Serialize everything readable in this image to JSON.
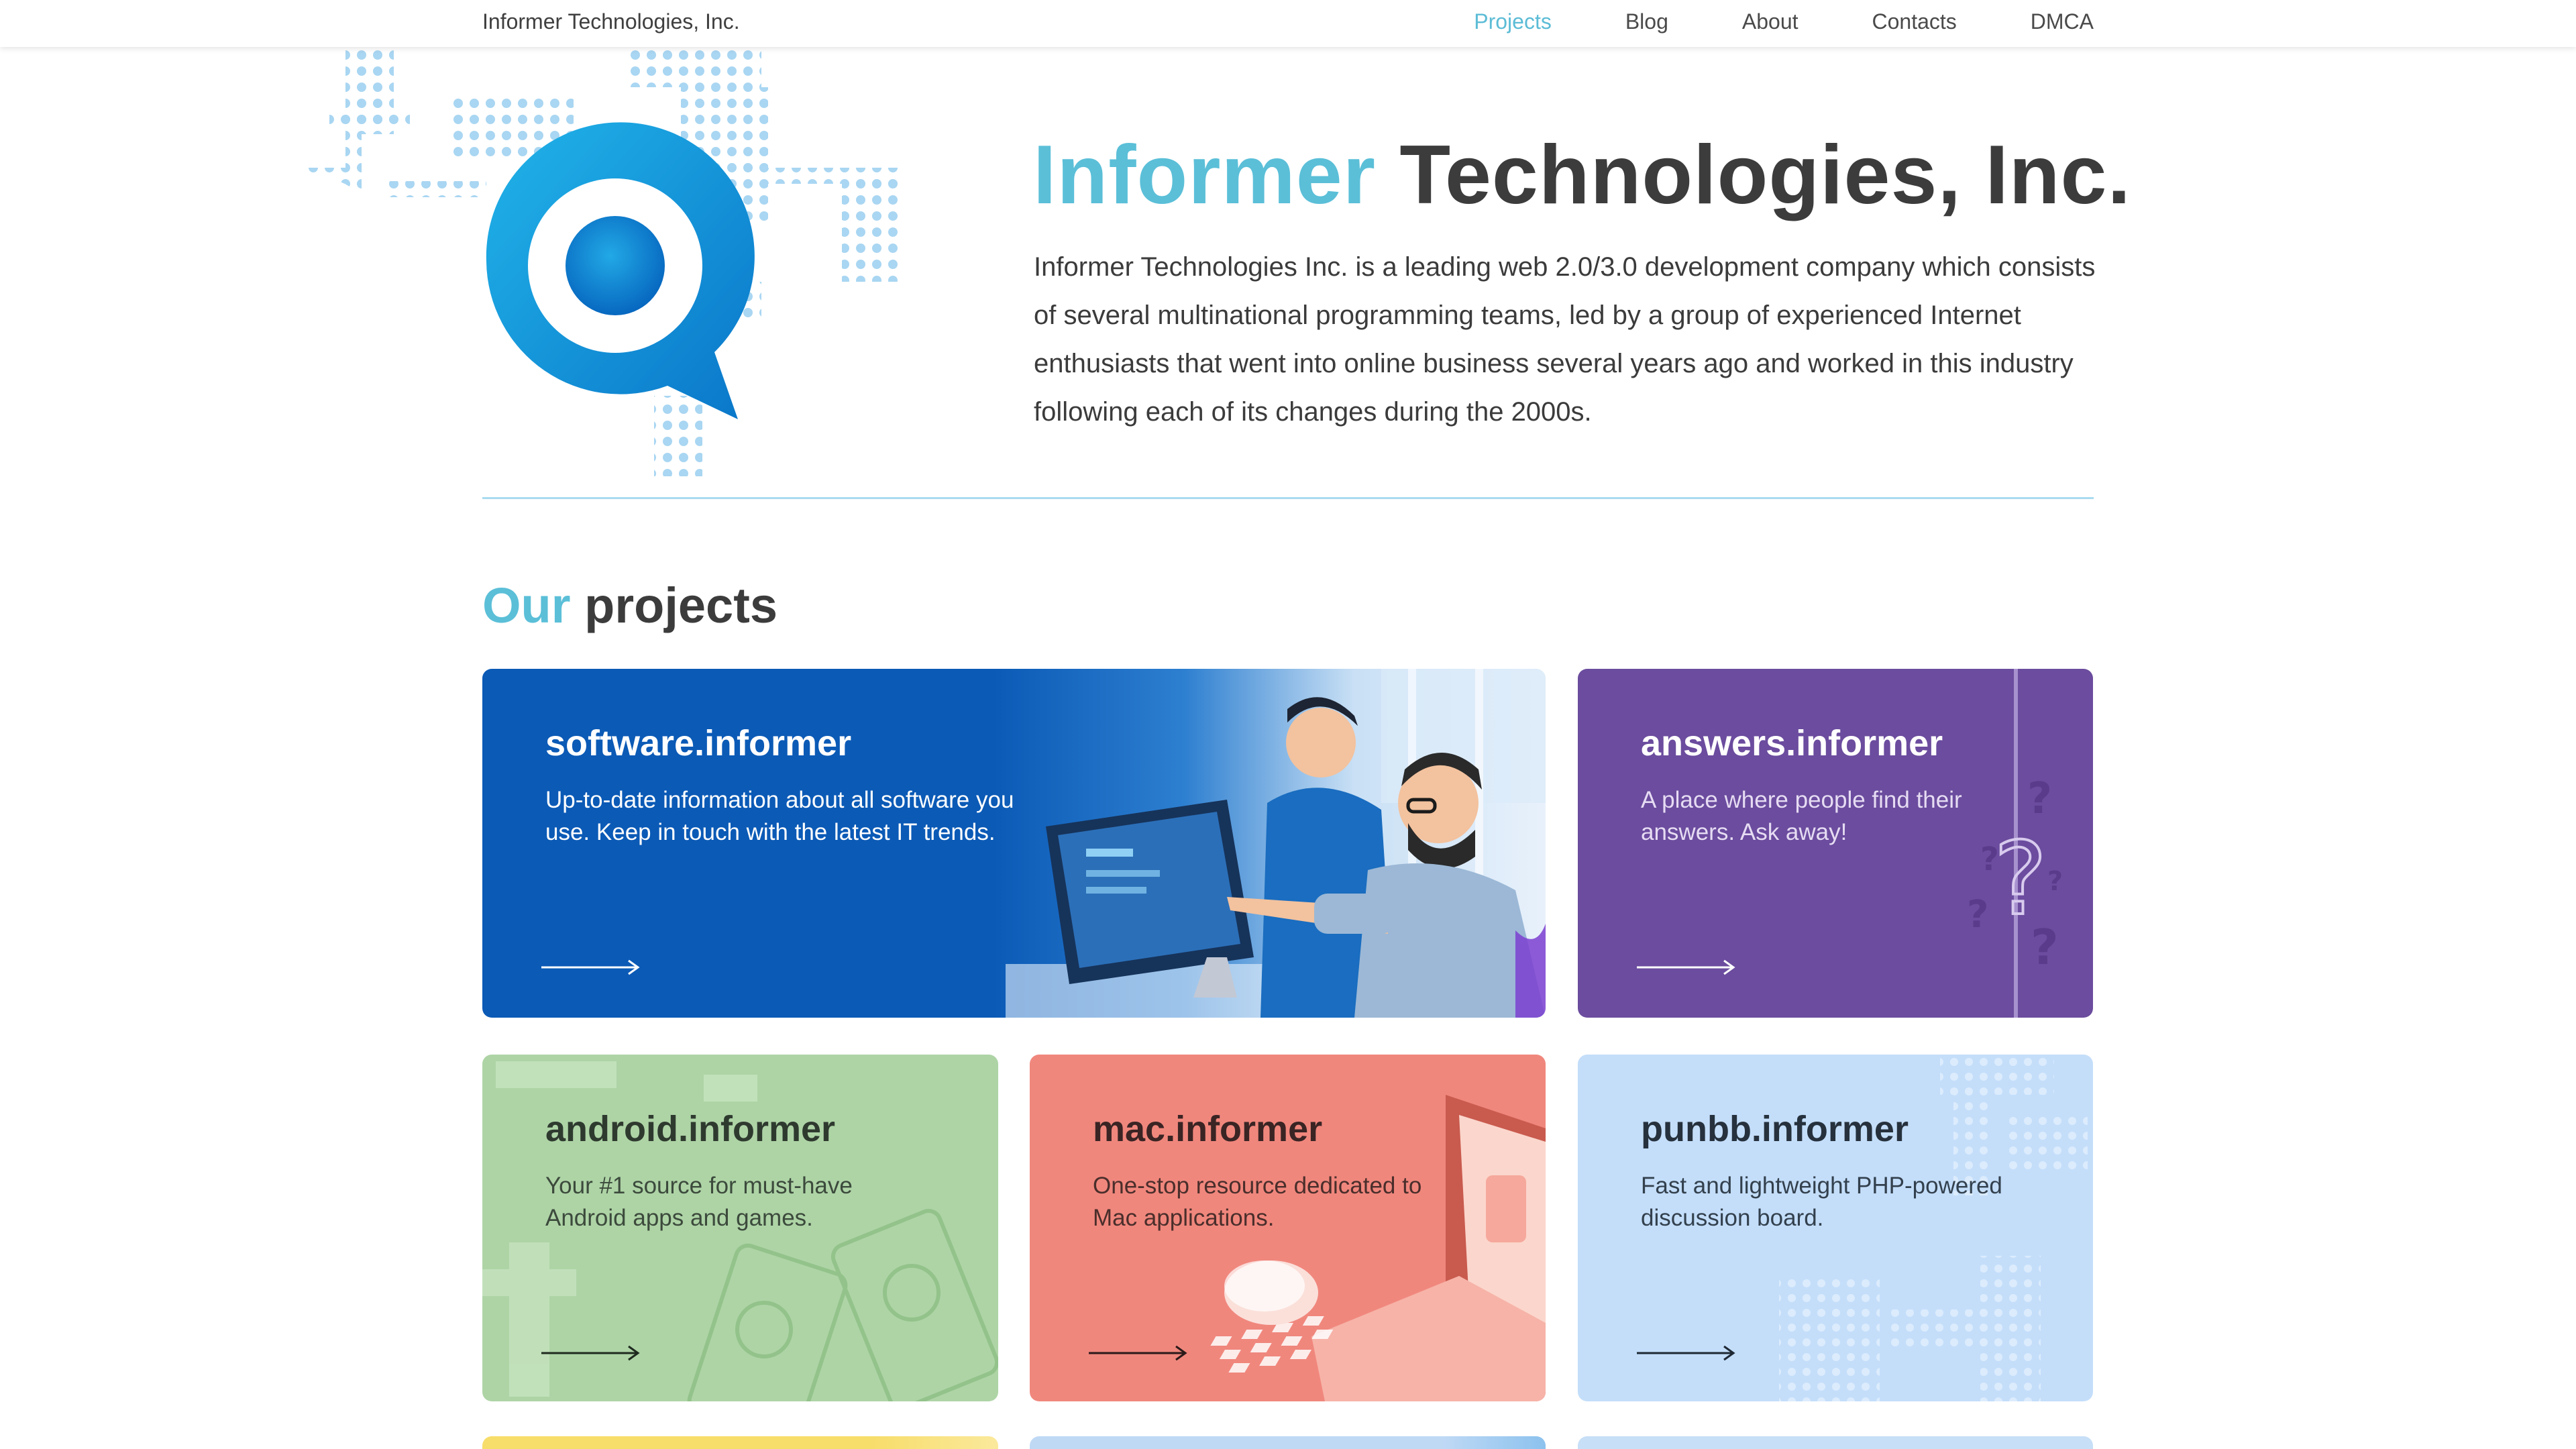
{
  "header": {
    "brand": "Informer Technologies, Inc.",
    "nav": [
      {
        "label": "Projects",
        "active": true
      },
      {
        "label": "Blog",
        "active": false
      },
      {
        "label": "About",
        "active": false
      },
      {
        "label": "Contacts",
        "active": false
      },
      {
        "label": "DMCA",
        "active": false
      }
    ]
  },
  "hero": {
    "title_accent": "Informer",
    "title_rest": "Technologies, Inc.",
    "description": "Informer Technologies Inc. is a leading web 2.0/3.0 development company which consists of several multinational programming teams, led by a group of experienced Internet enthusiasts that went into online business several years ago and worked in this industry following each of its changes during the 2000s."
  },
  "projects": {
    "heading_accent": "Our",
    "heading_rest": "projects",
    "cards": [
      {
        "title": "software.informer",
        "description": "Up-to-date information about all software you use. Keep in touch with the latest IT trends.",
        "color": "#0b5ab6"
      },
      {
        "title": "answers.informer",
        "description": "A place where people find their answers. Ask away!",
        "color": "#6b4c9e"
      },
      {
        "title": "android.informer",
        "description": "Your #1 source for must-have Android apps and games.",
        "color": "#aed4a6"
      },
      {
        "title": "mac.informer",
        "description": "One-stop resource dedicated to Mac applications.",
        "color": "#f0877d"
      },
      {
        "title": "punbb.informer",
        "description": "Fast and lightweight PHP-powered discussion board.",
        "color": "#c4defa"
      }
    ]
  },
  "icons": [
    "informer-logo-icon",
    "arrow-right-icon",
    "question-mark-icon"
  ],
  "colors": {
    "accent": "#5bbfd8",
    "text": "#3c3c3c"
  }
}
